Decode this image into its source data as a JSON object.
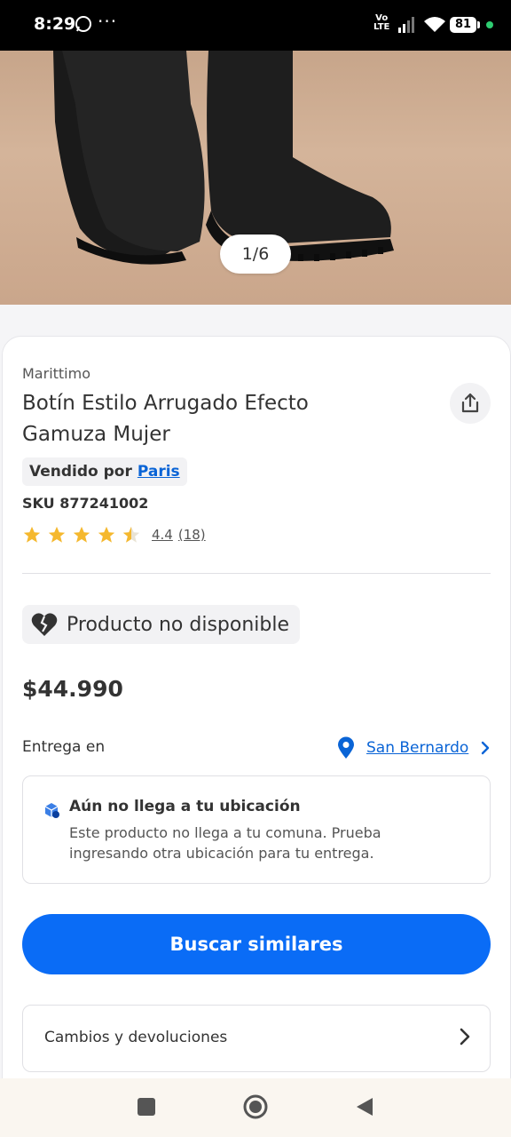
{
  "status_bar": {
    "time": "8:29",
    "battery": "81",
    "network": "Vo\nLTE",
    "icons": [
      "whatsapp-icon",
      "more-dots-icon",
      "volte-icon",
      "signal-icon",
      "wifi-icon",
      "battery-icon"
    ]
  },
  "gallery": {
    "counter": "1/6"
  },
  "product": {
    "brand": "Marittimo",
    "title": "Botín Estilo Arrugado Efecto Gamuza Mujer",
    "seller_prefix": "Vendido por",
    "seller_name": "Paris",
    "sku": "SKU 877241002",
    "rating_value": "4.4",
    "rating_count": "(18)",
    "rating_stars": 4.4
  },
  "availability": {
    "label": "Producto no disponible"
  },
  "price": "$44.990",
  "delivery": {
    "label": "Entrega en",
    "location": "San Bernardo"
  },
  "notice": {
    "title": "Aún no llega a tu ubicación",
    "body": "Este producto no llega a tu comuna. Prueba ingresando otra ubicación para tu entrega."
  },
  "actions": {
    "primary_label": "Buscar similares",
    "returns_label": "Cambios y devoluciones"
  },
  "colors": {
    "primary": "#0a6cf6",
    "link": "#0a64d6",
    "star": "#f5b82e"
  }
}
